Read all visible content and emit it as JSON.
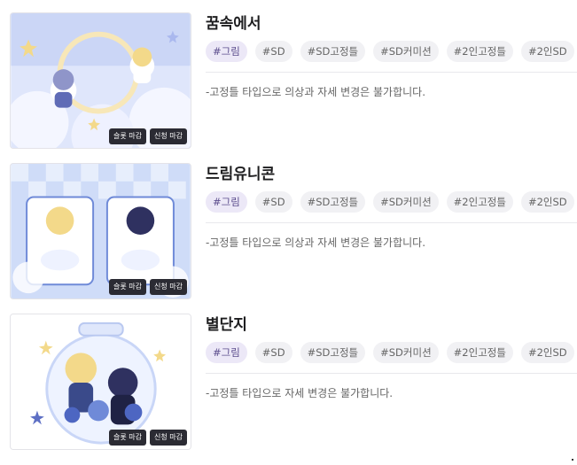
{
  "items": [
    {
      "title": "꿈속에서",
      "tags": [
        "#그림",
        "#SD",
        "#SD고정틀",
        "#SD커미션",
        "#2인고정틀",
        "#2인SD"
      ],
      "description": "-고정틀 타입으로 의상과 자세 변경은 불가합니다.",
      "badges": [
        "슬롯 마감",
        "신청 마감"
      ]
    },
    {
      "title": "드림유니콘",
      "tags": [
        "#그림",
        "#SD",
        "#SD고정틀",
        "#SD커미션",
        "#2인고정틀",
        "#2인SD"
      ],
      "description": "-고정틀 타입으로 의상과 자세 변경은 불가합니다.",
      "badges": [
        "슬롯 마감",
        "신청 마감"
      ]
    },
    {
      "title": "별단지",
      "tags": [
        "#그림",
        "#SD",
        "#SD고정틀",
        "#SD커미션",
        "#2인고정틀",
        "#2인SD"
      ],
      "description": "-고정틀 타입으로 자세 변경은 불가합니다.",
      "badges": [
        "슬롯 마감",
        "신청 마감"
      ]
    }
  ],
  "colors": {
    "tag_active_bg": "#ece8f7",
    "tag_bg": "#f1f1f4",
    "badge_bg": "#2b2b33"
  }
}
